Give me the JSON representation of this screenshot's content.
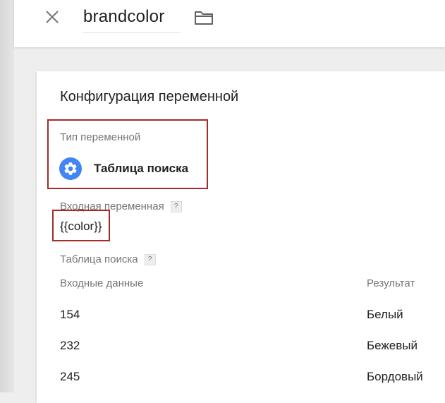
{
  "header": {
    "variable_name": "brandcolor",
    "close_icon": "close-icon",
    "folder_icon": "folder-icon"
  },
  "config": {
    "section_title": "Конфигурация переменной",
    "type_label": "Тип переменной",
    "type_name": "Таблица поиска",
    "type_icon": "gear-icon",
    "input_label": "Входная переменная",
    "input_value": "{{color}}",
    "help_glyph": "?",
    "lookup_label": "Таблица поиска",
    "columns": {
      "input": "Входные данные",
      "output": "Результат"
    },
    "rows": [
      {
        "input": "154",
        "output": "Белый"
      },
      {
        "input": "232",
        "output": "Бежевый"
      },
      {
        "input": "245",
        "output": "Бордовый"
      }
    ]
  },
  "colors": {
    "accent": "#4285f4",
    "highlight_border": "#a52a2a",
    "muted_text": "#757575",
    "page_bg": "#eeeeee"
  }
}
